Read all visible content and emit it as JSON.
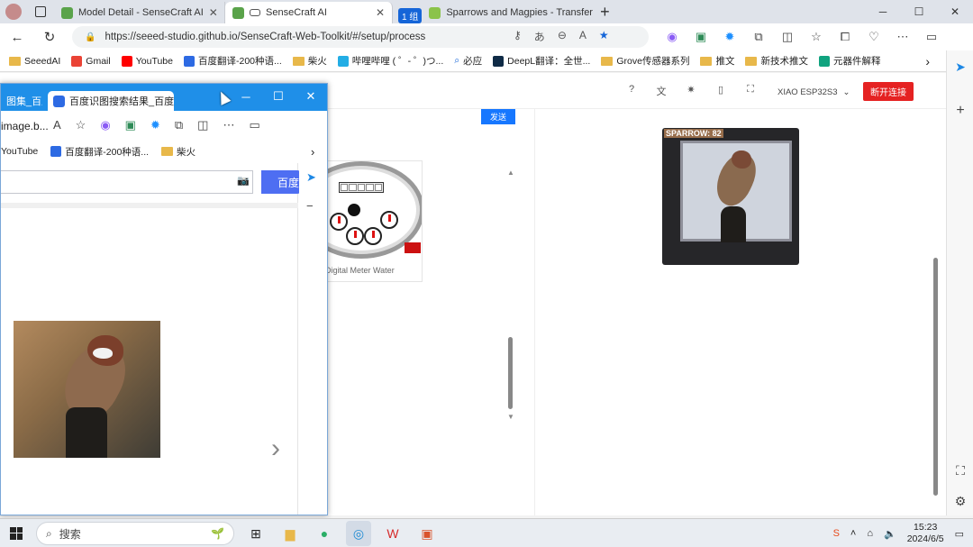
{
  "browser": {
    "tabs": [
      {
        "label": "Model Detail - SenseCraft AI",
        "color": "#5aa34a",
        "active": false
      },
      {
        "label": "SenseCraft AI",
        "color": "#5aa34a",
        "active": true
      },
      {
        "label": "Sparrows and Magpies - Transfer",
        "color": "#8bc34a",
        "active": false
      }
    ],
    "tab_group_label": "1 组",
    "url": "https://seeed-studio.github.io/SenseCraft-Web-Toolkit/#/setup/process",
    "bookmarks": [
      "SeeedAI",
      "Gmail",
      "YouTube",
      "百度翻译-200种语...",
      "柴火",
      "哔哩哔哩 ( ゜- ゜)つ...",
      "必应",
      "DeepL翻译：全世...",
      "Grove传感器系列",
      "推文",
      "新技术推文",
      "元器件解释"
    ]
  },
  "page": {
    "device": "XIAO ESP32S3",
    "disconnect_label": "断开连接",
    "send_label": "发送",
    "model_card_title": "Digital Meter Water",
    "preview_label": "SPARROW: 82"
  },
  "float_window": {
    "tab1_label": "图集_百度...",
    "tab2_label": "百度识图搜索结果_百度",
    "address_text": "image.b...",
    "bookmarks": [
      "YouTube",
      "百度翻译-200种语...",
      "柴火"
    ],
    "search_button": "百度"
  },
  "taskbar": {
    "search_placeholder": "搜索",
    "time": "15:23",
    "date": "2024/6/5"
  },
  "colors": {
    "accent": "#1677ff",
    "danger": "#e52222",
    "float_titlebar": "#1f8fe8"
  }
}
